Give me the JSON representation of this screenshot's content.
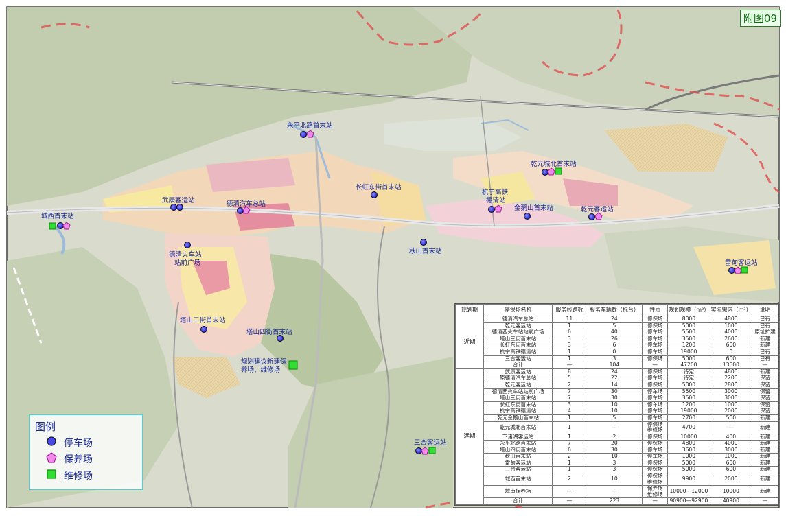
{
  "map_badge": "附图09",
  "stations": [
    {
      "id": "yongping",
      "label": "永平北路首末站"
    },
    {
      "id": "qianyuan-north",
      "label": "乾元城北首末站"
    },
    {
      "id": "changhong",
      "label": "长虹东街首末站"
    },
    {
      "id": "hangning-1",
      "label": "杭宁高铁"
    },
    {
      "id": "hangning-2",
      "label": "德清站"
    },
    {
      "id": "jinge",
      "label": "金鹅山首末站"
    },
    {
      "id": "qianyuan-bus",
      "label": "乾元客运站"
    },
    {
      "id": "wukang",
      "label": "武康客运站"
    },
    {
      "id": "deqing-bus",
      "label": "德清汽车总站"
    },
    {
      "id": "chengxi",
      "label": "城西首末站"
    },
    {
      "id": "train-1",
      "label": "德清火车站"
    },
    {
      "id": "train-2",
      "label": "站前广场"
    },
    {
      "id": "qiushan",
      "label": "秋山首末站"
    },
    {
      "id": "leidian",
      "label": "雷甸客运站"
    },
    {
      "id": "tashan3",
      "label": "塔山三街首末站"
    },
    {
      "id": "tashan4",
      "label": "塔山四街首末站"
    },
    {
      "id": "new-1",
      "label": "规划建议新建保"
    },
    {
      "id": "new-2",
      "label": "养场、维修场"
    },
    {
      "id": "sanhe",
      "label": "三合客运站"
    }
  ],
  "legend": {
    "title": "图例",
    "items": [
      {
        "label": "停车场",
        "icon": "blue-circle-icon",
        "color": "#2a2ad8"
      },
      {
        "label": "保养场",
        "icon": "pink-pentagon-icon",
        "color": "#e040d0"
      },
      {
        "label": "维修场",
        "icon": "green-square-icon",
        "color": "#22cc22"
      }
    ]
  },
  "table": {
    "headers": [
      "规划期",
      "停保场名称",
      "服务线路数",
      "服务车辆数（标台）",
      "性质",
      "规划规模（m²）",
      "实际需求（m²）",
      "说明"
    ],
    "near": {
      "group": "近期",
      "rows": [
        [
          "德清汽车总站",
          "11",
          "24",
          "停保场",
          "8000",
          "4800",
          "已有"
        ],
        [
          "乾元客运站",
          "1",
          "5",
          "停保场",
          "5000",
          "1000",
          "已有"
        ],
        [
          "德清西火车站站前广场",
          "6",
          "40",
          "停车场",
          "5500",
          "4000",
          "原址扩建"
        ],
        [
          "塔山三街首末站",
          "3",
          "26",
          "停车场",
          "3500",
          "2600",
          "新建"
        ],
        [
          "长虹东街首末站",
          "3",
          "6",
          "停车场",
          "1200",
          "600",
          "新建"
        ],
        [
          "杭宁高铁德清站",
          "1",
          "0",
          "停车场",
          "19000",
          "0",
          "已有"
        ],
        [
          "三合客运站",
          "1",
          "3",
          "停保场",
          "5000",
          "600",
          "已有"
        ],
        [
          "合计",
          "—",
          "104",
          "—",
          "47200",
          "13600",
          "—"
        ]
      ]
    },
    "far": {
      "group": "远期",
      "rows": [
        [
          "武康客运站",
          "8",
          "24",
          "停保场",
          "待定",
          "4800",
          "新建"
        ],
        [
          "原德清汽车总站",
          "5",
          "22",
          "停车场",
          "待定",
          "2200",
          "保留"
        ],
        [
          "乾元客运站",
          "2",
          "14",
          "停保场",
          "5000",
          "2800",
          "保留"
        ],
        [
          "德清西火车站站前广场",
          "7",
          "30",
          "停车场",
          "5500",
          "3000",
          "保留"
        ],
        [
          "塔山三街首末站",
          "7",
          "30",
          "停车场",
          "3500",
          "3000",
          "保留"
        ],
        [
          "长虹东街首末站",
          "3",
          "10",
          "停车场",
          "1200",
          "1000",
          "保留"
        ],
        [
          "杭宁高铁德清站",
          "4",
          "10",
          "停车场",
          "19000",
          "2000",
          "保留"
        ],
        [
          "乾元金鹅山首末站",
          "1",
          "5",
          "停车场",
          "2700",
          "500",
          "新建"
        ],
        [
          "乾元城北首末站",
          "1",
          "—",
          "停保场\n维修场",
          "4700",
          "—",
          "新建"
        ],
        [
          "下渚湖客运站",
          "1",
          "2",
          "停保场",
          "10000",
          "400",
          "新建"
        ],
        [
          "永平北路首末站",
          "7",
          "20",
          "停保场",
          "4800",
          "4000",
          "新建"
        ],
        [
          "塔山四街首末站",
          "6",
          "30",
          "停车场",
          "3600",
          "3000",
          "新建"
        ],
        [
          "秋山首末站",
          "2",
          "10",
          "停车场",
          "1000",
          "1000",
          "新建"
        ],
        [
          "雷甸客运站",
          "1",
          "3",
          "停保场",
          "5000",
          "600",
          "新建"
        ],
        [
          "三合客运站",
          "1",
          "3",
          "停保场",
          "5000",
          "600",
          "新建"
        ],
        [
          "城西首末站",
          "2",
          "10",
          "停保场\n维修场",
          "9900",
          "2000",
          "新建"
        ],
        [
          "城南保养场",
          "—",
          "—",
          "保养场\n维修场",
          "10000—12000",
          "10000",
          "新建"
        ],
        [
          "合计",
          "—",
          "223",
          "—",
          "90900—92900",
          "40900",
          "—"
        ]
      ]
    }
  }
}
